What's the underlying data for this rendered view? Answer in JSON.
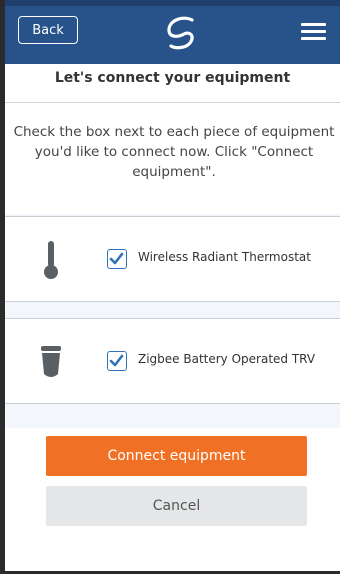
{
  "header": {
    "back_label": "Back",
    "logo": "swirl-logo",
    "menu_icon": "hamburger-menu-icon",
    "bar_color": "#27528a"
  },
  "main": {
    "title": "Let's connect your equipment",
    "instructions": "Check the box next to each piece of equipment you'd like to connect now. Click \"Connect equipment\"."
  },
  "equipment": [
    {
      "label": "Wireless Radiant Thermostat",
      "icon": "thermometer-icon",
      "checked": true
    },
    {
      "label": "Zigbee Battery Operated TRV",
      "icon": "trv-valve-icon",
      "checked": true
    }
  ],
  "buttons": {
    "connect_label": "Connect equipment",
    "cancel_label": "Cancel",
    "connect_color": "#f07125",
    "cancel_color": "#e4e6e8"
  },
  "colors": {
    "checkbox_accent": "#2f73b8",
    "list_background": "#f3f7fb"
  }
}
